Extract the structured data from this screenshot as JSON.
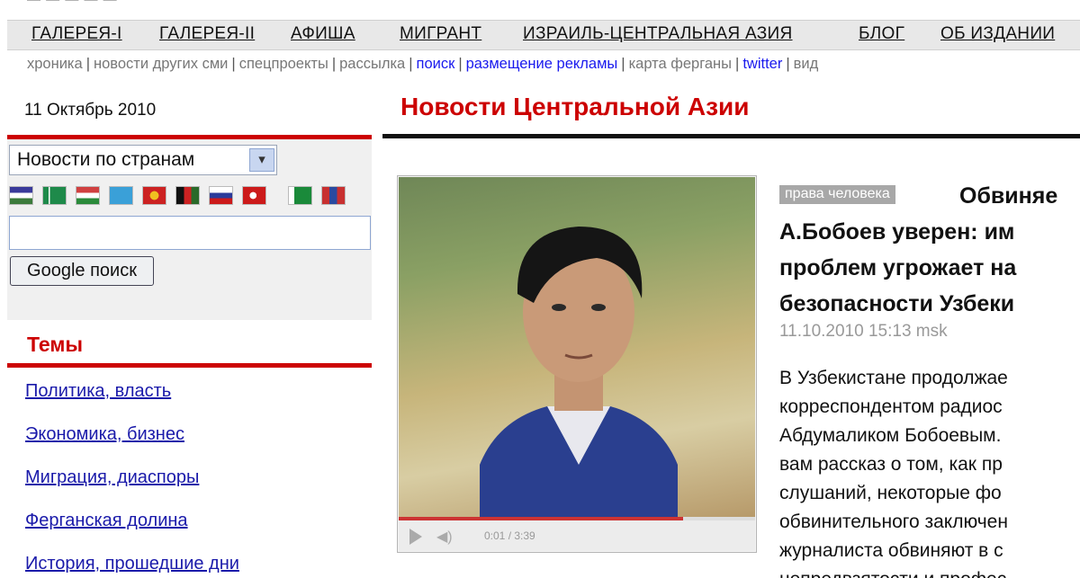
{
  "top_sliver": {
    "text": "— — — — —"
  },
  "main_nav": {
    "items": [
      {
        "label": "ГАЛЕРЕЯ-I"
      },
      {
        "label": "ГАЛЕРЕЯ-II"
      },
      {
        "label": "АФИША"
      },
      {
        "label": "МИГРАНТ"
      },
      {
        "label": "ИЗРАИЛЬ-ЦЕНТРАЛЬНАЯ АЗИЯ"
      },
      {
        "label": "БЛОГ"
      },
      {
        "label": "ОБ ИЗДАНИИ"
      }
    ]
  },
  "sub_nav": {
    "items": [
      {
        "label": "хроника"
      },
      {
        "label": "новости других сми"
      },
      {
        "label": "спецпроекты"
      },
      {
        "label": "рассылка"
      },
      {
        "label": "поиск"
      },
      {
        "label": "размещение рекламы"
      },
      {
        "label": "карта ферганы"
      },
      {
        "label": "twitter"
      },
      {
        "label": "вид"
      }
    ],
    "separator": "|"
  },
  "sidebar": {
    "date": "11 Октябрь 2010",
    "country_select": "Новости по странам",
    "search_value": "",
    "google_button": "Google поиск",
    "topics_title": "Темы",
    "topics": [
      {
        "label": "Политика, власть"
      },
      {
        "label": "Экономика, бизнес"
      },
      {
        "label": "Миграция, диаспоры"
      },
      {
        "label": "Ферганская долина"
      },
      {
        "label": "История, прошедшие дни"
      }
    ],
    "flag_colors": [
      "#3b7a3b",
      "#1e8a4a",
      "#d04040",
      "#3aa0d8",
      "#cc2222",
      "#2a6a2a",
      "#2a3a9a",
      "#cc1a1a",
      "#1a8a3a",
      "#c83030"
    ]
  },
  "main": {
    "section_title": "Новости Центральной Азии",
    "video": {
      "time": "0:01 / 3:39"
    },
    "article": {
      "tag": "права человека",
      "title_lines": [
        "Обвиняе",
        "А.Бобоев уверен: им",
        "проблем угрожает на",
        "безопасности Узбеки"
      ],
      "timestamp": "11.10.2010 15:13 msk",
      "body_lines": [
        "В Узбекистане продолжае",
        "корреспондентом радиос",
        "Абдумаликом Бобоевым.",
        "вам рассказ о том, как пр",
        "слушаний, некоторые фо",
        "обвинительного заключен",
        "журналиста обвиняют в с",
        "непредвзятости и профес"
      ]
    }
  }
}
